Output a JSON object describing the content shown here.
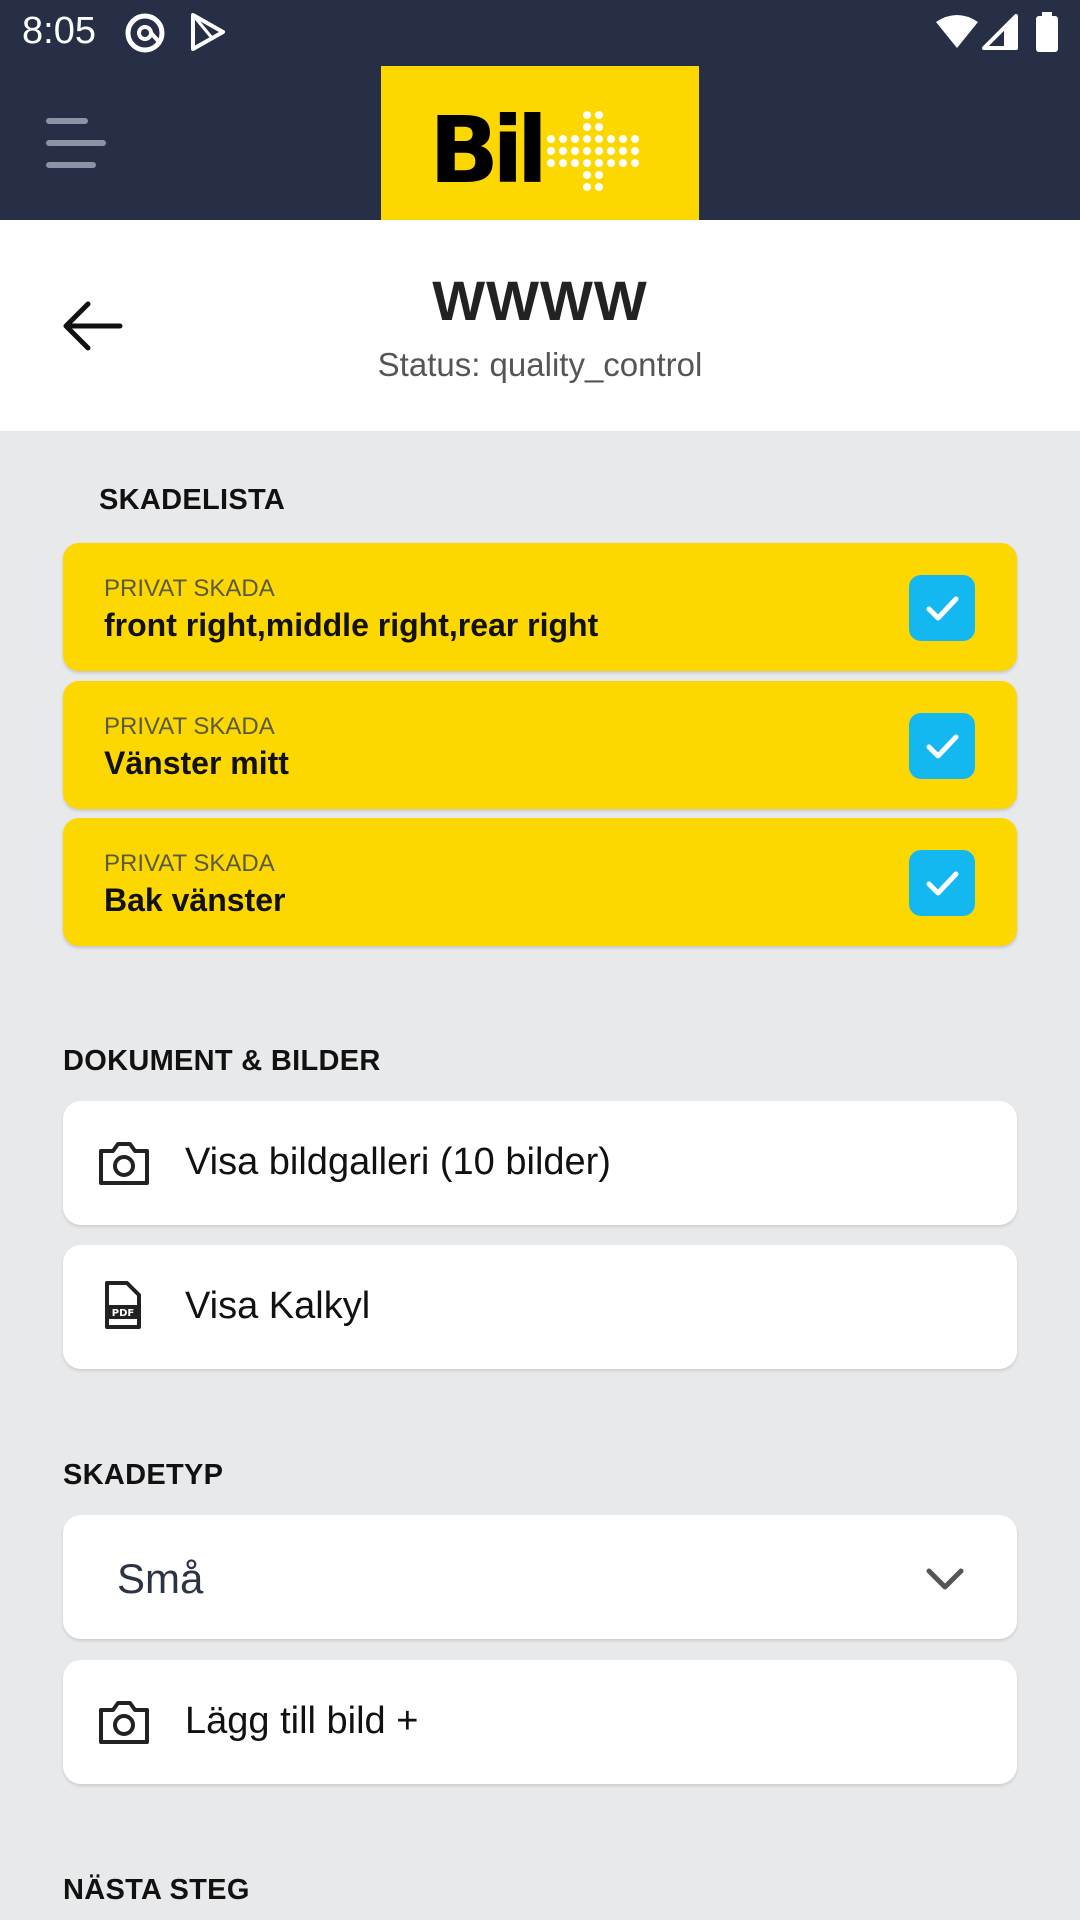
{
  "status_bar": {
    "time": "8:05",
    "icons": [
      "at-sign-icon",
      "play-store-icon",
      "wifi-icon",
      "signal-icon",
      "battery-icon"
    ]
  },
  "app_bar": {
    "logo_text": "Bil+",
    "logo_color": "#fdd700",
    "background": "#262f45"
  },
  "header": {
    "title": "WWWW",
    "status": "Status: quality_control"
  },
  "skadelista": {
    "heading": "SKADELISTA",
    "items": [
      {
        "type": "PRIVAT SKADA",
        "name": "front right,middle right,rear right",
        "checked": true
      },
      {
        "type": "PRIVAT SKADA",
        "name": "Vänster mitt",
        "checked": true
      },
      {
        "type": "PRIVAT SKADA",
        "name": "Bak vänster",
        "checked": true
      }
    ]
  },
  "documents": {
    "heading": "DOKUMENT & BILDER",
    "gallery_label": "Visa bildgalleri (10 bilder)",
    "calc_label": "Visa Kalkyl"
  },
  "skadetyp": {
    "heading": "SKADETYP",
    "selected": "Små",
    "add_image_label": "Lägg till bild +"
  },
  "next_step": {
    "heading": "NÄSTA STEG"
  },
  "colors": {
    "accent_yellow": "#fdd700",
    "check_blue": "#14b8f0",
    "background": "#e8e9eb"
  }
}
